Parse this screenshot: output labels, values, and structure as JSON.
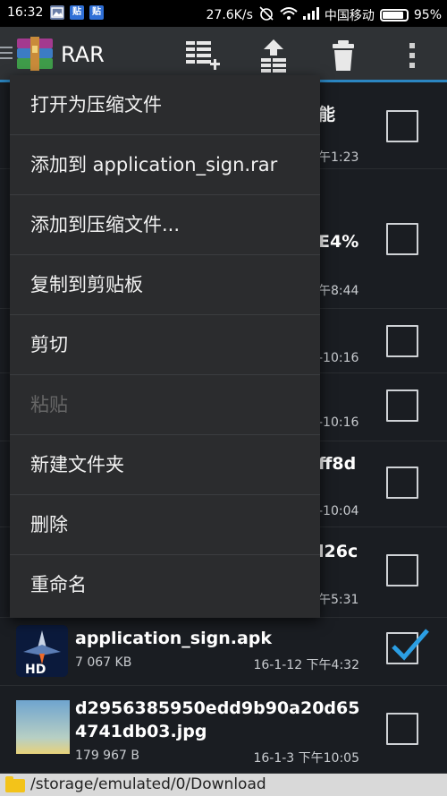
{
  "status_bar": {
    "time": "16:32",
    "notif_icons": [
      "gallery-icon",
      "paste-icon-blue",
      "paste-icon-blue"
    ],
    "net_speed": "27.6K/s",
    "carrier": "中国移动",
    "battery": "95%",
    "battery_level": 0.95
  },
  "appbar": {
    "title": "RAR",
    "icons": [
      "add-to-archive-icon",
      "extract-up-icon",
      "delete-icon",
      "overflow-menu-icon"
    ]
  },
  "list": {
    "rows": [
      {
        "title_tail": "能",
        "date_tail": "午1:23",
        "checked": false
      },
      {
        "title_tail": "E4%",
        "date_tail": "午8:44",
        "checked": false
      },
      {
        "title_tail": "",
        "date_tail": "-10:16",
        "checked": false
      },
      {
        "title_tail": "",
        "date_tail": "-10:16",
        "checked": false
      },
      {
        "title_tail": "ff8d",
        "date_tail": "-10:04",
        "checked": false
      },
      {
        "title_tail": "l26c",
        "date_tail": "午5:31",
        "checked": false
      }
    ],
    "apk": {
      "title": "application_sign.apk",
      "size": "7 067 KB",
      "date": "16-1-12 下午4:32",
      "checked": true
    },
    "jpg": {
      "title_line1": "d2956385950edd9b90a20d65",
      "title_line2": "4741db03.jpg",
      "size": "179 967 B",
      "date": "16-1-3 下午10:05",
      "checked": false
    }
  },
  "path": "/storage/emulated/0/Download",
  "menu": {
    "items": [
      {
        "label": "打开为压缩文件",
        "enabled": true
      },
      {
        "label": "添加到 application_sign.rar",
        "enabled": true
      },
      {
        "label": "添加到压缩文件...",
        "enabled": true
      },
      {
        "label": "复制到剪贴板",
        "enabled": true
      },
      {
        "label": "剪切",
        "enabled": true
      },
      {
        "label": "粘贴",
        "enabled": false
      },
      {
        "label": "新建文件夹",
        "enabled": true
      },
      {
        "label": "删除",
        "enabled": true
      },
      {
        "label": "重命名",
        "enabled": true
      }
    ]
  },
  "colors": {
    "accent": "#2b86c2",
    "check": "#2b9ee3",
    "appbar": "#2f3235",
    "menu_bg": "#2b2c2e"
  }
}
